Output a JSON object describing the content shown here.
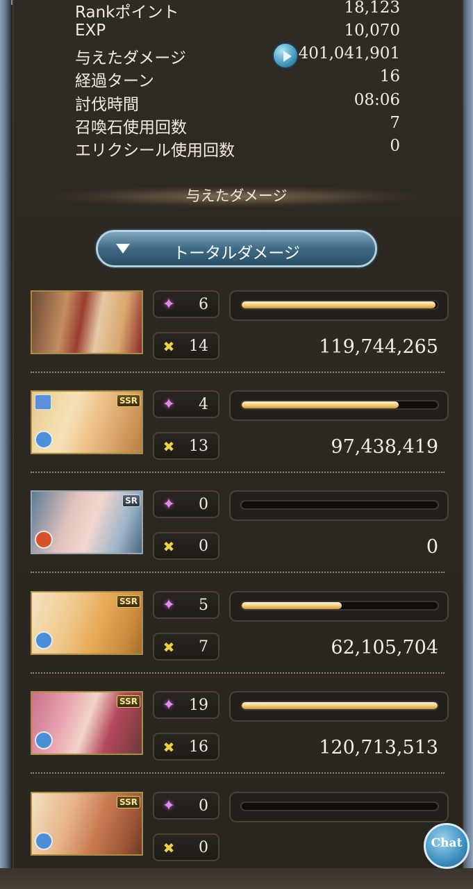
{
  "stats": [
    {
      "label": "Rankポイント",
      "value": "18,123"
    },
    {
      "label": "EXP",
      "value": "10,070"
    },
    {
      "label": "与えたダメージ",
      "value": "401,041,901"
    },
    {
      "label": "経過ターン",
      "value": "16"
    },
    {
      "label": "討伐時間",
      "value": "08:06"
    },
    {
      "label": "召喚石使用回数",
      "value": "7"
    },
    {
      "label": "エリクシール使用回数",
      "value": "0"
    }
  ],
  "section": {
    "title": "与えたダメージ"
  },
  "dropdown": {
    "label": "トータルダメージ"
  },
  "characters": [
    {
      "rarity": "",
      "element": "",
      "charge": "6",
      "attacks": "14",
      "damage": "119,744,265",
      "bar_fraction": 0.99
    },
    {
      "rarity": "SSR",
      "element": "water",
      "charge": "4",
      "attacks": "13",
      "damage": "97,438,419",
      "bar_fraction": 0.8
    },
    {
      "rarity": "SR",
      "element": "fire",
      "charge": "0",
      "attacks": "0",
      "damage": "0",
      "bar_fraction": 0.0
    },
    {
      "rarity": "SSR",
      "element": "water",
      "charge": "5",
      "attacks": "7",
      "damage": "62,105,704",
      "bar_fraction": 0.51
    },
    {
      "rarity": "SSR",
      "element": "water",
      "charge": "19",
      "attacks": "16",
      "damage": "120,713,513",
      "bar_fraction": 1.0
    },
    {
      "rarity": "SSR",
      "element": "water",
      "charge": "0",
      "attacks": "0",
      "damage": "",
      "bar_fraction": 0.0
    }
  ],
  "chat": {
    "label": "Chat"
  },
  "colors": {
    "bar_gold": "#f2cc7a",
    "water": "#4d8fd6",
    "fire": "#d8532c"
  }
}
